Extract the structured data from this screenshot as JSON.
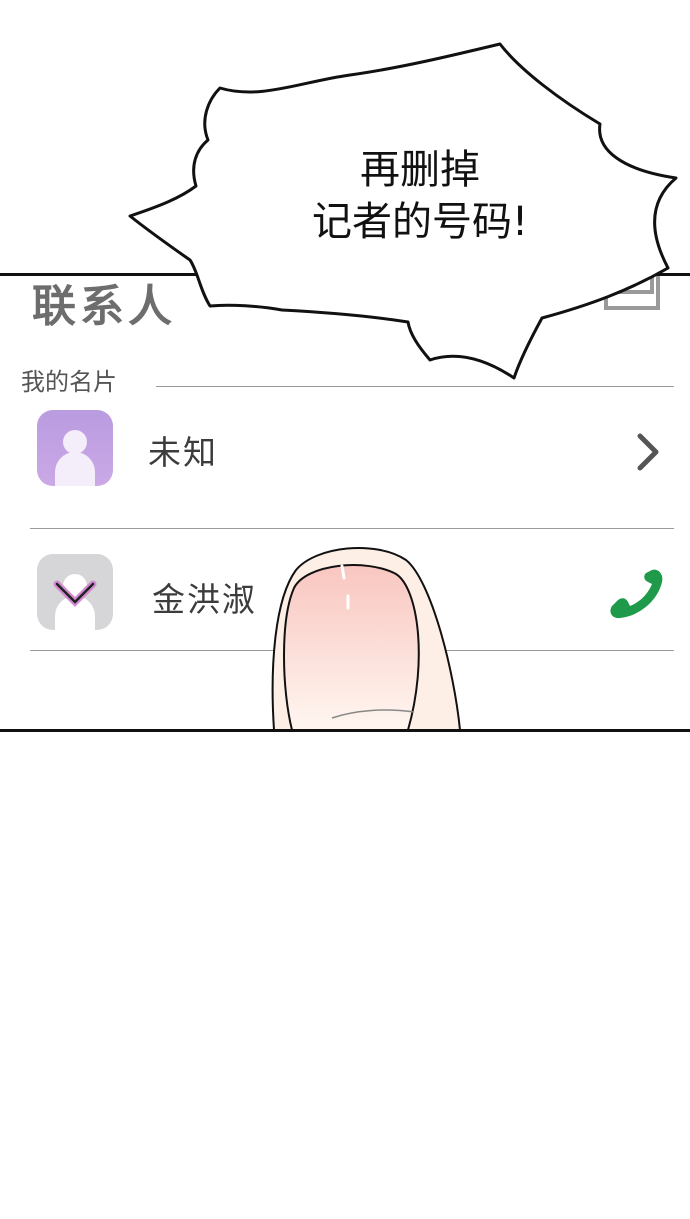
{
  "screen": {
    "title": "联系人",
    "section_label": "我的名片",
    "contacts": [
      {
        "name": "未知",
        "avatar_color": "#b99be0",
        "trailing_icon": "chevron-right-icon"
      },
      {
        "name": "金洪淑",
        "avatar_color": "#d6d6d8",
        "trailing_icon": "phone-icon",
        "trailing_color": "#1e9a4a"
      }
    ]
  },
  "speech_bubble": {
    "line1": "再删掉",
    "line2": "记者的号码!"
  },
  "colors": {
    "panel_border": "#111111",
    "divider": "#9a9a9a",
    "finger_nail": "#f9c6c0"
  }
}
